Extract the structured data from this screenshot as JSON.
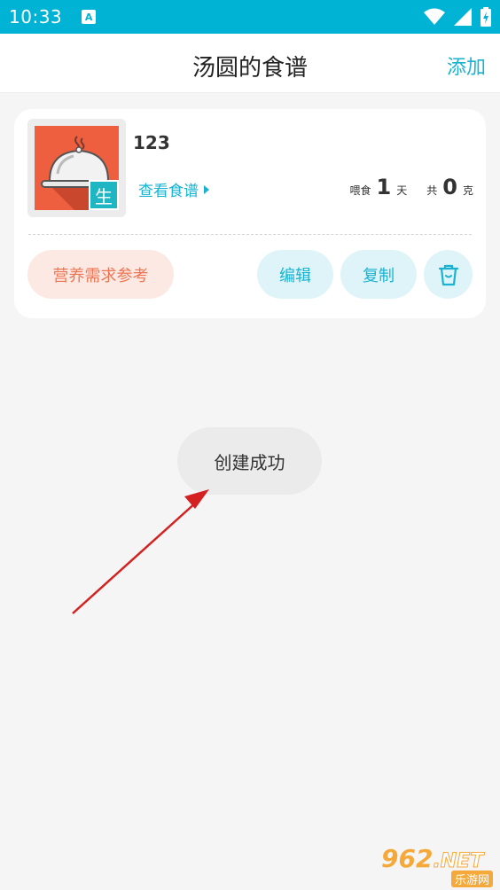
{
  "status_bar": {
    "time": "10:33",
    "notification_letter": "A",
    "icons": [
      "wifi-icon",
      "signal-icon",
      "battery-icon"
    ]
  },
  "app_bar": {
    "title": "汤圆的食谱",
    "add_label": "添加"
  },
  "recipe_card": {
    "name": "123",
    "badge": "生",
    "view_label": "查看食谱",
    "feed_label": "喂食",
    "feed_days": "1",
    "days_unit": "天",
    "total_label": "共",
    "total_grams": "0",
    "grams_unit": "克",
    "buttons": {
      "nutrition": "营养需求参考",
      "edit": "编辑",
      "copy": "复制",
      "delete_icon": "trash-icon"
    }
  },
  "toast": {
    "message": "创建成功"
  },
  "watermark": {
    "main": "962",
    "suffix": ".NET",
    "sub": "乐游网"
  },
  "colors": {
    "primary": "#00b3d4",
    "accent_text": "#1ab2d0",
    "thumb_bg": "#ee5f3f",
    "nutrition_bg": "#fde9e4",
    "nutrition_text": "#ef7552",
    "pill_bg": "#dff4f8",
    "arrow": "#d42020"
  }
}
